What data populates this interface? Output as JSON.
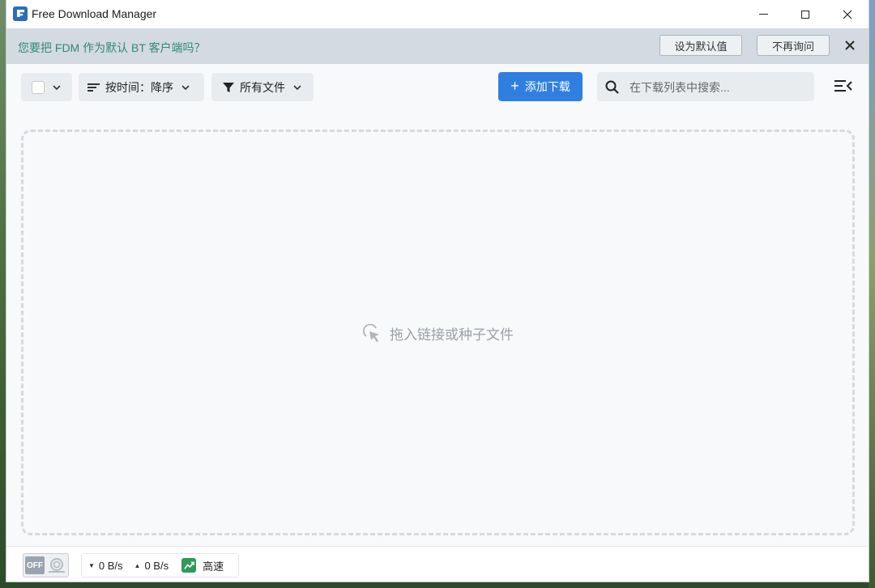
{
  "window": {
    "title": "Free Download Manager"
  },
  "notice": {
    "text": "您要把 FDM 作为默认 BT 客户端吗？",
    "set_default_label": "设为默认值",
    "never_ask_label": "不再询问"
  },
  "toolbar": {
    "sort_label": "按时间：降序",
    "filter_label": "所有文件",
    "add_label": "添加下载"
  },
  "search": {
    "placeholder": "在下载列表中搜索..."
  },
  "dropzone": {
    "hint": "拖入链接或种子文件"
  },
  "statusbar": {
    "toggle_label": "OFF",
    "download_speed": "0 B/s",
    "upload_speed": "0 B/s",
    "mode_label": "高速"
  },
  "colors": {
    "accent": "#2f7fe0",
    "notice_text": "#2f8a78",
    "notice_bg": "#d3dae1",
    "mode_icon": "#2e9a5a"
  },
  "icons": [
    "app-logo-icon",
    "minimize-icon",
    "maximize-icon",
    "close-icon",
    "chevron-down-icon",
    "sort-icon",
    "filter-icon",
    "plus-icon",
    "search-icon",
    "menu-collapse-icon",
    "drag-pointer-icon",
    "snail-icon",
    "trend-up-icon"
  ]
}
